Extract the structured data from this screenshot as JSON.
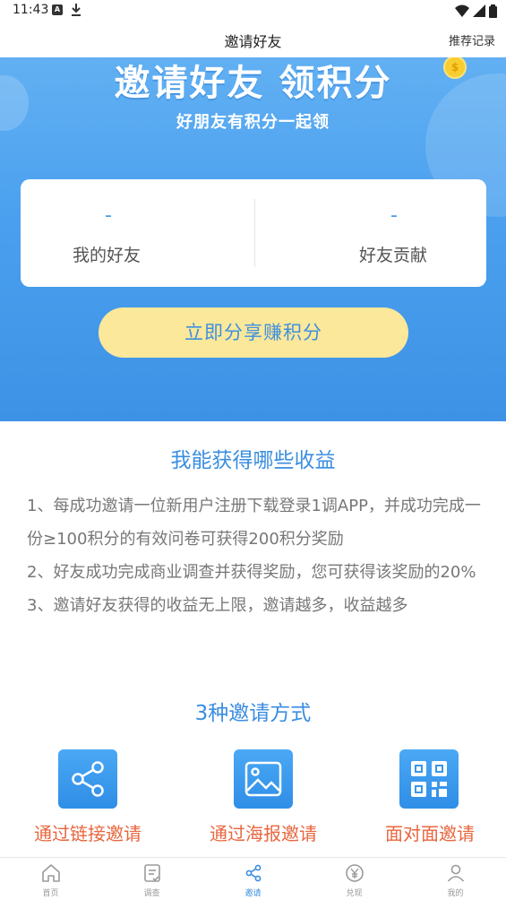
{
  "status_bar": {
    "time": "11:43",
    "notification_icon": "a-icon",
    "download_icon": "download-icon"
  },
  "nav": {
    "title": "邀请好友",
    "right_link": "推荐记录"
  },
  "hero": {
    "title": "邀请好友 领积分",
    "subtitle": "好朋友有积分一起领",
    "stats": {
      "friends_value": "-",
      "friends_label": "我的好友",
      "contribution_value": "-",
      "contribution_label": "好友贡献"
    },
    "share_button": "立即分享赚积分"
  },
  "benefits": {
    "title": "我能获得哪些收益",
    "items": [
      "1、每成功邀请一位新用户注册下载登录1调APP，并成功完成一份≥100积分的有效问卷可获得200积分奖励",
      "2、好友成功完成商业调查并获得奖励，您可获得该奖励的20%",
      "3、邀请好友获得的收益无上限，邀请越多，收益越多"
    ]
  },
  "methods": {
    "title": "3种邀请方式",
    "items": [
      {
        "label": "通过链接邀请",
        "icon": "share-icon"
      },
      {
        "label": "通过海报邀请",
        "icon": "image-icon"
      },
      {
        "label": "面对面邀请",
        "icon": "qrcode-icon"
      }
    ]
  },
  "tab_bar": {
    "items": [
      {
        "label": "首页",
        "icon": "home-icon"
      },
      {
        "label": "调查",
        "icon": "survey-icon"
      },
      {
        "label": "邀请",
        "icon": "share-icon",
        "active": true
      },
      {
        "label": "兑现",
        "icon": "yen-icon"
      },
      {
        "label": "我的",
        "icon": "user-icon"
      }
    ]
  },
  "colors": {
    "primary_blue": "#3a8ee0",
    "hero_gradient_top": "#62b0f3",
    "hero_gradient_bottom": "#3e92e6",
    "share_button_bg": "#fbe89a",
    "method_label": "#e8663e"
  }
}
